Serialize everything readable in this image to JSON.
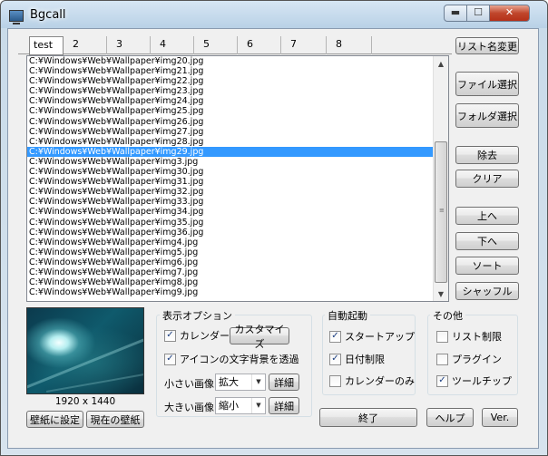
{
  "window": {
    "title": "Bgcall",
    "min_glyph": "▬",
    "max_glyph": "☐",
    "close_glyph": "✕"
  },
  "tabs": [
    "test",
    "2",
    "3",
    "4",
    "5",
    "6",
    "7",
    "8"
  ],
  "buttons": {
    "rename_list": "リスト名変更",
    "select_file": "ファイル選択",
    "select_folder": "フォルダ選択",
    "remove": "除去",
    "clear": "クリア",
    "up": "上へ",
    "down": "下へ",
    "sort": "ソート",
    "shuffle": "シャッフル",
    "set_wallpaper": "壁紙に設定",
    "current_wallpaper": "現在の壁紙",
    "exit": "終了",
    "help": "ヘルプ",
    "version": "Ver."
  },
  "file_list": {
    "items": [
      "C:¥Windows¥Web¥Wallpaper¥img20.jpg",
      "C:¥Windows¥Web¥Wallpaper¥img21.jpg",
      "C:¥Windows¥Web¥Wallpaper¥img22.jpg",
      "C:¥Windows¥Web¥Wallpaper¥img23.jpg",
      "C:¥Windows¥Web¥Wallpaper¥img24.jpg",
      "C:¥Windows¥Web¥Wallpaper¥img25.jpg",
      "C:¥Windows¥Web¥Wallpaper¥img26.jpg",
      "C:¥Windows¥Web¥Wallpaper¥img27.jpg",
      "C:¥Windows¥Web¥Wallpaper¥img28.jpg",
      "C:¥Windows¥Web¥Wallpaper¥img29.jpg",
      "C:¥Windows¥Web¥Wallpaper¥img3.jpg",
      "C:¥Windows¥Web¥Wallpaper¥img30.jpg",
      "C:¥Windows¥Web¥Wallpaper¥img31.jpg",
      "C:¥Windows¥Web¥Wallpaper¥img32.jpg",
      "C:¥Windows¥Web¥Wallpaper¥img33.jpg",
      "C:¥Windows¥Web¥Wallpaper¥img34.jpg",
      "C:¥Windows¥Web¥Wallpaper¥img35.jpg",
      "C:¥Windows¥Web¥Wallpaper¥img36.jpg",
      "C:¥Windows¥Web¥Wallpaper¥img4.jpg",
      "C:¥Windows¥Web¥Wallpaper¥img5.jpg",
      "C:¥Windows¥Web¥Wallpaper¥img6.jpg",
      "C:¥Windows¥Web¥Wallpaper¥img7.jpg",
      "C:¥Windows¥Web¥Wallpaper¥img8.jpg",
      "C:¥Windows¥Web¥Wallpaper¥img9.jpg"
    ],
    "selected_index": 9
  },
  "preview": {
    "resolution": "1920 x 1440"
  },
  "display_options": {
    "title": "表示オプション",
    "calendar": "カレンダー",
    "customize": "カスタマイズ",
    "icon_transparent": "アイコンの文字背景を透過",
    "small_image": "小さい画像",
    "small_image_value": "拡大",
    "large_image": "大きい画像",
    "large_image_value": "縮小",
    "detail": "詳細"
  },
  "autostart": {
    "title": "自動起動",
    "startup": "スタートアップ",
    "date_limit": "日付制限",
    "calendar_only": "カレンダーのみ"
  },
  "other": {
    "title": "その他",
    "list_limit": "リスト制限",
    "plugin": "プラグイン",
    "tooltip": "ツールチップ"
  },
  "checkbox_states": {
    "calendar": true,
    "icon_transparent": true,
    "startup": true,
    "date_limit": true,
    "calendar_only": false,
    "list_limit": false,
    "plugin": false,
    "tooltip": true
  },
  "colors": {
    "selection": "#3399ff",
    "close_button": "#c0462c"
  },
  "icons": {
    "app": "monitor-icon",
    "scroll_up": "▲",
    "scroll_down": "▼",
    "dropdown": "▼",
    "check": "✓"
  }
}
